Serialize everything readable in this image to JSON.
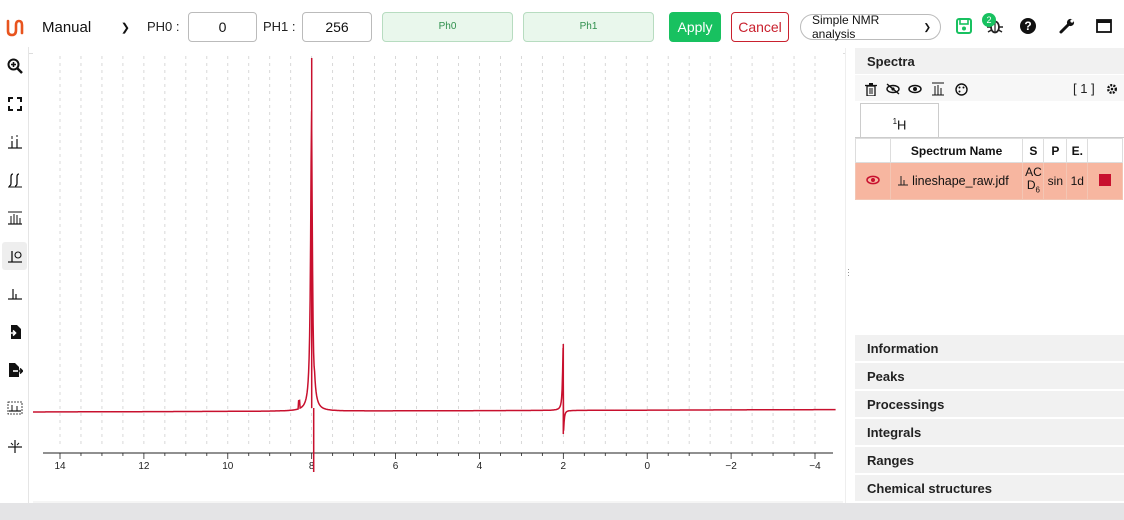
{
  "toolbar": {
    "mode_value": "Manual",
    "ph0_label": "PH0 :",
    "ph0_value": "0",
    "ph1_label": "PH1 :",
    "ph1_value": "256",
    "ph0_slider_label": "Ph0",
    "ph1_slider_label": "Ph1",
    "apply_label": "Apply",
    "cancel_label": "Cancel",
    "workspace_value": "Simple NMR analysis",
    "notification_count": "2"
  },
  "left_tools": [
    "zoom-in-icon",
    "fullscreen-icon",
    "peak-picking-icon",
    "integral-icon",
    "multiplet-analysis-icon",
    "phase-correction-icon",
    "baseline-correction-icon",
    "import-icon",
    "export-icon",
    "exclusion-zone-icon",
    "apodization-icon"
  ],
  "spectrum": {
    "x_ticks": [
      "14",
      "12",
      "10",
      "8",
      "6",
      "4",
      "2",
      "0",
      "−2",
      "−4"
    ],
    "line_color": "#c8102e"
  },
  "panel": {
    "spectra_title": "Spectra",
    "count": "[ 1 ]",
    "nucleus_tab_sup": "1",
    "nucleus_tab": "H",
    "columns": [
      "Spectrum Name",
      "S",
      "P",
      "E."
    ],
    "row": {
      "name": "lineshape_raw.jdf",
      "solvent": "AC",
      "solvent2": "D",
      "solvent_sub": "6",
      "pulse": "sin",
      "experiment": "1d",
      "color": "#c8102e"
    },
    "sections": [
      "Information",
      "Peaks",
      "Processings",
      "Integrals",
      "Ranges",
      "Chemical structures"
    ]
  },
  "colors": {
    "accent_green": "#18c160",
    "cancel_red": "#c9212e",
    "row_highlight": "#f7b6a0"
  }
}
